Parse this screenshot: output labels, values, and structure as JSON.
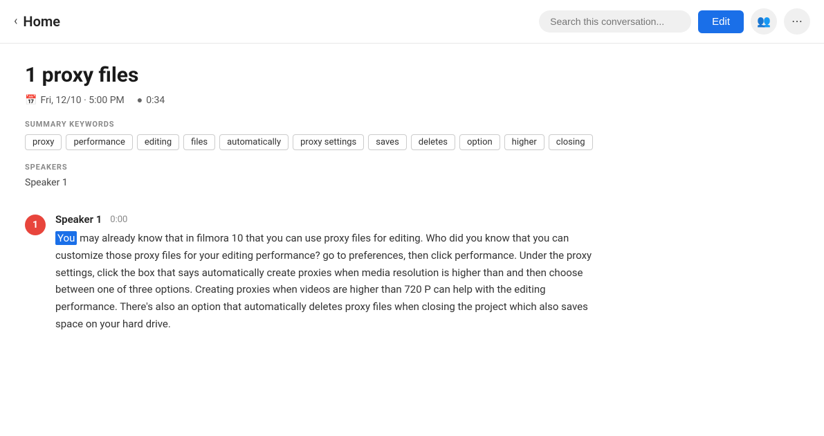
{
  "topbar": {
    "home_label": "Home",
    "search_placeholder": "Search this conversation...",
    "edit_label": "Edit",
    "add_person_icon": "add-person",
    "more_icon": "more"
  },
  "note": {
    "title": "1 proxy files",
    "date": "Fri, 12/10 · 5:00 PM",
    "duration": "0:34"
  },
  "summary": {
    "section_label": "SUMMARY KEYWORDS",
    "keywords": [
      "proxy",
      "performance",
      "editing",
      "files",
      "automatically",
      "proxy settings",
      "saves",
      "deletes",
      "option",
      "higher",
      "closing"
    ]
  },
  "speakers_section": {
    "label": "SPEAKERS",
    "speakers": [
      "Speaker 1"
    ]
  },
  "transcript": [
    {
      "badge_number": "1",
      "speaker": "Speaker 1",
      "time": "0:00",
      "highlight_word": "You",
      "text_after": " may already know that in filmora 10 that you can use proxy files for editing. Who did you know that you can customize those proxy files for your editing performance? go to preferences, then click performance. Under the proxy settings, click the box that says automatically create proxies when media resolution is higher than and then choose between one of three options. Creating proxies when videos are higher than 720 P can help with the editing performance. There's also an option that automatically deletes proxy files when closing the project which also saves space on your hard drive."
    }
  ]
}
